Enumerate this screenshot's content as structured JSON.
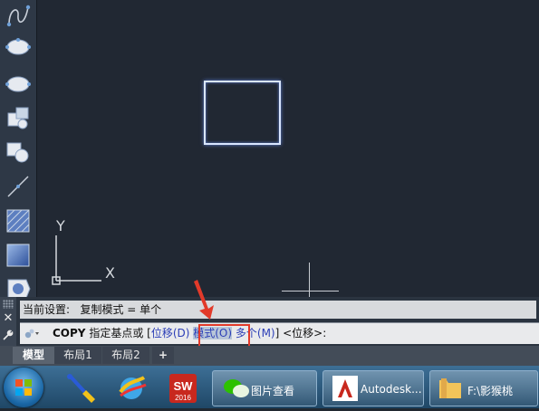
{
  "canvas": {
    "tools": [
      "spline-icon",
      "ellipse-icon",
      "ellipse-arc-icon",
      "insert-block-icon",
      "create-block-icon",
      "point-icon",
      "hatch-icon",
      "gradient-icon",
      "region-icon"
    ],
    "ucs_y": "Y",
    "ucs_x": "X"
  },
  "command": {
    "history_text": "当前设置:   复制模式 = 单个",
    "cmd_name": "COPY",
    "prompt": " 指定基点或 [",
    "opt1": "位移(D)",
    "opt2": "模式(O)",
    "opt3": "多个(M)",
    "suffix": "] <位移>:"
  },
  "tabs": {
    "model": "模型",
    "layout1": "布局1",
    "layout2": "布局2",
    "add": "+"
  },
  "taskbar": {
    "start": "start-orb-icon",
    "items": [
      {
        "icon": "tool-app-icon"
      },
      {
        "icon": "globe-app-icon"
      },
      {
        "icon": "solidworks-icon",
        "label": "SW",
        "sublabel": "2016"
      },
      {
        "icon": "wechat-icon"
      },
      {
        "label": "图片查看",
        "icon": "image-viewer-icon"
      },
      {
        "label": "Autodesk...",
        "icon": "autodesk-icon"
      },
      {
        "label": "F:\\影猴桃",
        "icon": "folder-icon"
      }
    ]
  },
  "colors": {
    "canvas_bg": "#212833",
    "rect_stroke": "#d9e6ff",
    "highlight_box": "#e23a2a",
    "option_blue": "#2c3fb7"
  }
}
